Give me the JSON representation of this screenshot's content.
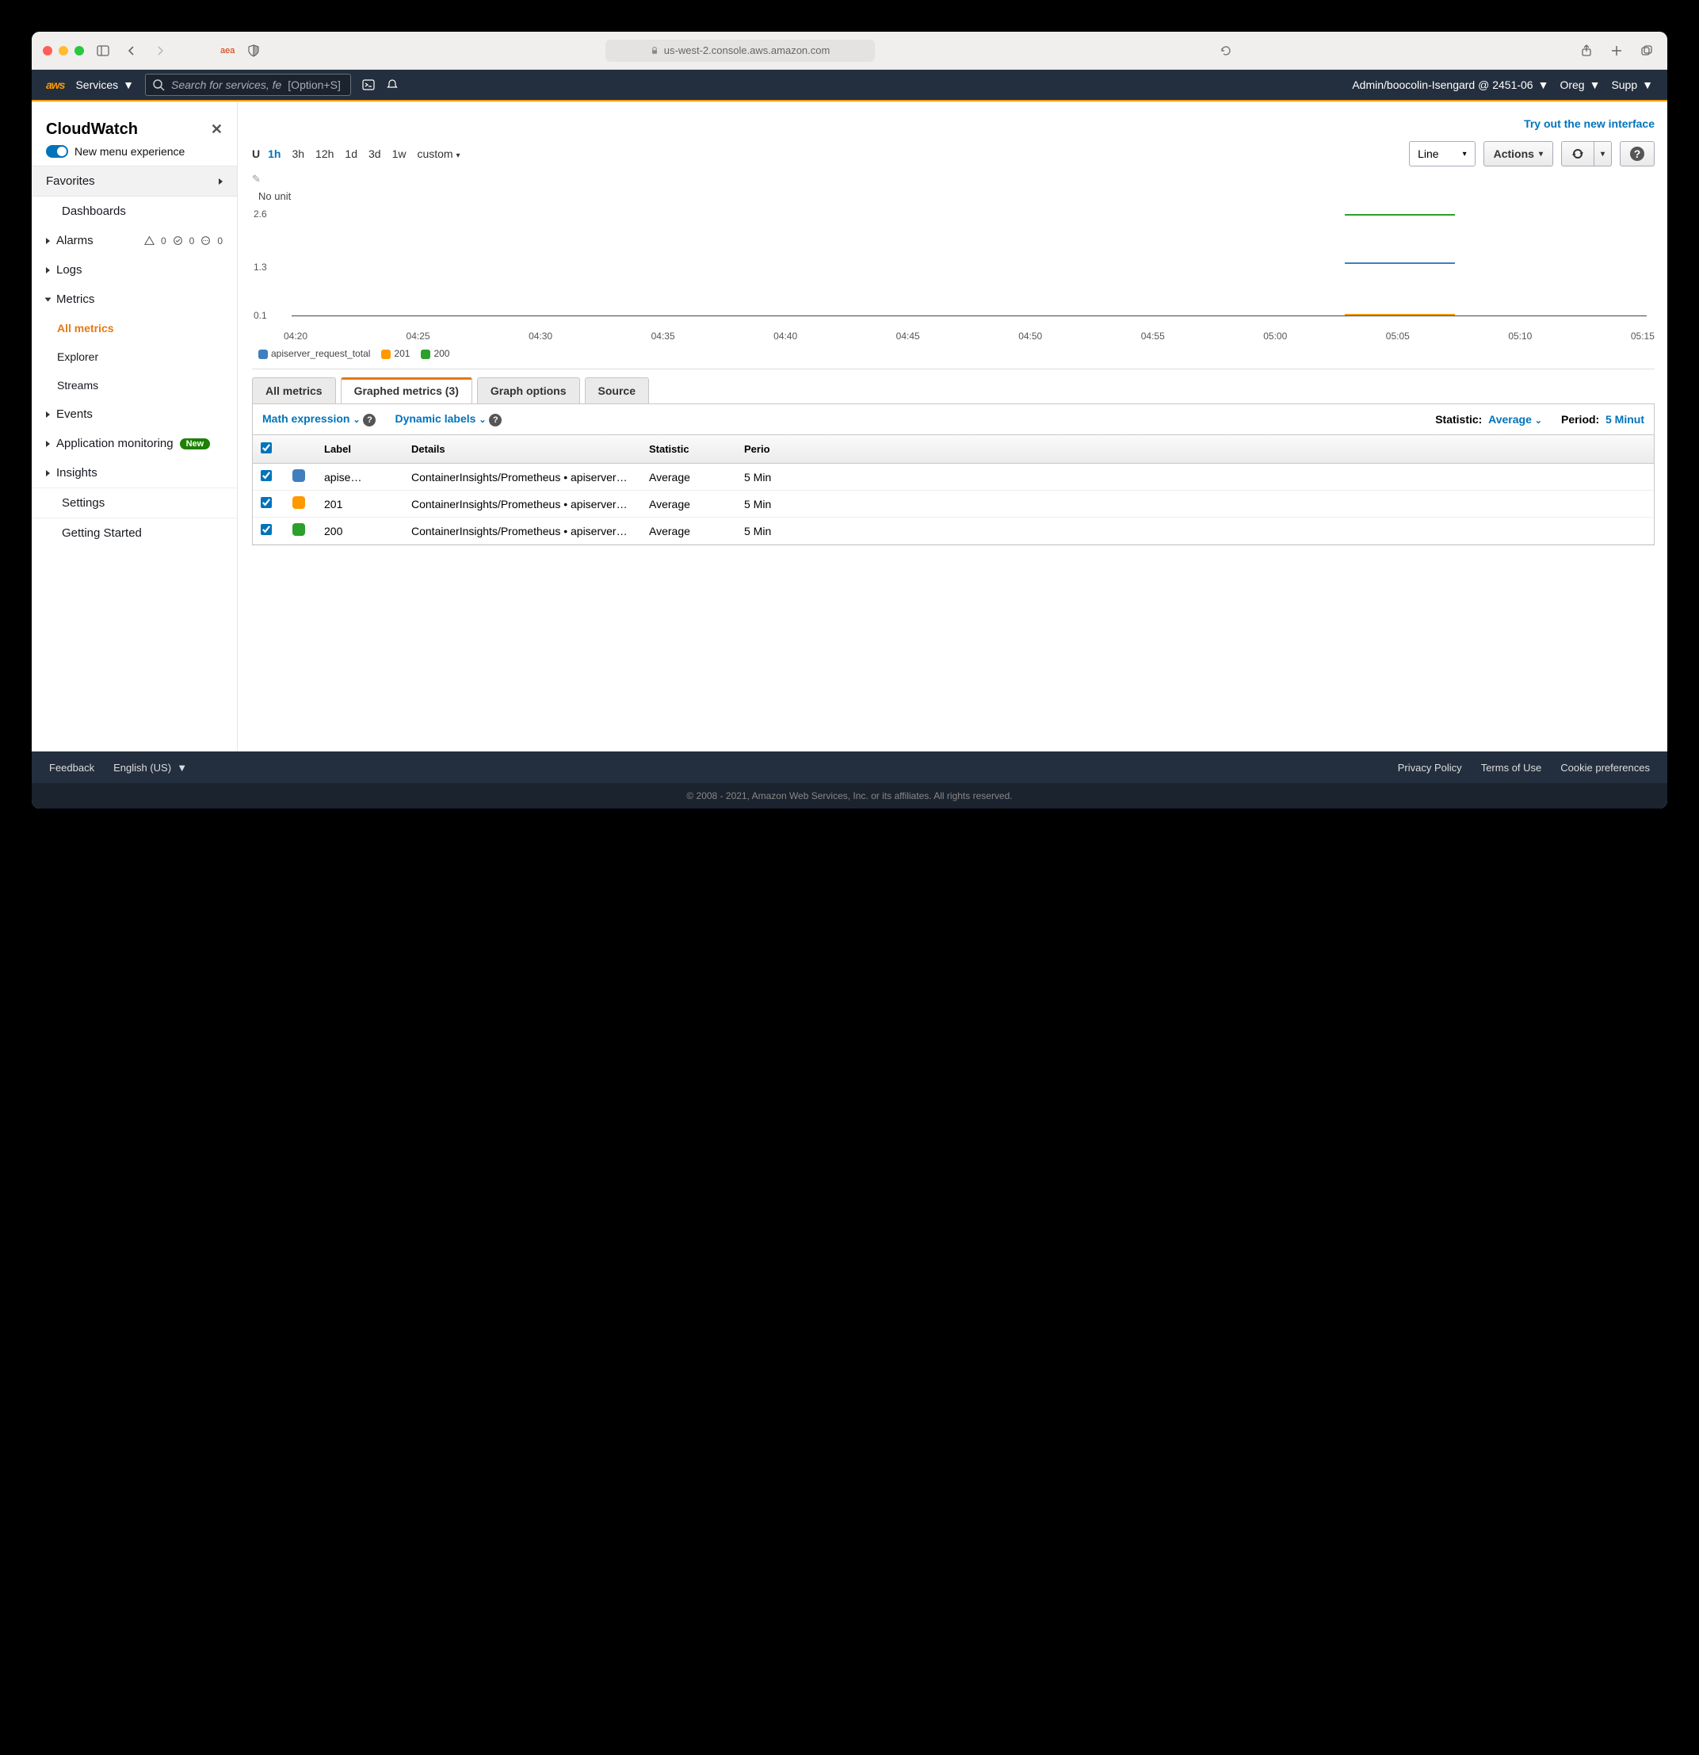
{
  "browser": {
    "url": "us-west-2.console.aws.amazon.com",
    "ext_label": "aea"
  },
  "aws_header": {
    "logo": "aws",
    "services": "Services",
    "search_placeholder": "Search for services, fe",
    "search_shortcut": "[Option+S]",
    "role": "Admin/boocolin-Isengard @ 2451-06",
    "region": "Oreg",
    "support": "Supp"
  },
  "sidebar": {
    "title": "CloudWatch",
    "new_menu": "New menu experience",
    "favorites": "Favorites",
    "items": [
      {
        "label": "Dashboards",
        "type": "plain"
      },
      {
        "label": "Alarms",
        "type": "expand",
        "counts": [
          "0",
          "0",
          "0"
        ]
      },
      {
        "label": "Logs",
        "type": "expand"
      },
      {
        "label": "Metrics",
        "type": "expanded",
        "children": [
          {
            "label": "All metrics",
            "active": true
          },
          {
            "label": "Explorer"
          },
          {
            "label": "Streams"
          }
        ]
      },
      {
        "label": "Events",
        "type": "expand"
      },
      {
        "label": "Application monitoring",
        "type": "expand",
        "badge": "New"
      },
      {
        "label": "Insights",
        "type": "expand"
      },
      {
        "label": "Settings",
        "type": "plain"
      },
      {
        "label": "Getting Started",
        "type": "plain"
      }
    ]
  },
  "main": {
    "try_link": "Try out the new interface",
    "time_ranges": [
      "1h",
      "3h",
      "12h",
      "1d",
      "3d",
      "1w",
      "custom"
    ],
    "time_active": "1h",
    "chart_type": "Line",
    "actions": "Actions",
    "y_unit": "No unit",
    "tabs": {
      "all": "All metrics",
      "graphed": "Graphed metrics (3)",
      "options": "Graph options",
      "source": "Source"
    },
    "toolbar2": {
      "math": "Math expression",
      "dyn": "Dynamic labels",
      "stat_label": "Statistic:",
      "stat_value": "Average",
      "period_label": "Period:",
      "period_value": "5 Minut"
    },
    "columns": {
      "label": "Label",
      "details": "Details",
      "statistic": "Statistic",
      "period": "Perio"
    },
    "rows": [
      {
        "color": "#3f7fbf",
        "label": "apise…",
        "details": "ContainerInsights/Prometheus • apiserver_…",
        "stat": "Average",
        "period": "5 Min"
      },
      {
        "color": "#ff9900",
        "label": "201",
        "details": "ContainerInsights/Prometheus • apiserver_…",
        "stat": "Average",
        "period": "5 Min"
      },
      {
        "color": "#2ca02c",
        "label": "200",
        "details": "ContainerInsights/Prometheus • apiserver_…",
        "stat": "Average",
        "period": "5 Min"
      }
    ]
  },
  "chart_data": {
    "type": "line",
    "title": "No unit",
    "ylabel": "",
    "ylim": [
      0.1,
      2.6
    ],
    "yticks": [
      0.1,
      1.3,
      2.6
    ],
    "x": [
      "04:20",
      "04:25",
      "04:30",
      "04:35",
      "04:40",
      "04:45",
      "04:50",
      "04:55",
      "05:00",
      "05:05",
      "05:10",
      "05:15"
    ],
    "series": [
      {
        "name": "apiserver_request_total",
        "color": "#3f7fbf",
        "values": [
          null,
          null,
          null,
          null,
          null,
          null,
          null,
          null,
          null,
          1.45,
          1.4,
          null
        ]
      },
      {
        "name": "201",
        "color": "#ff9900",
        "values": [
          null,
          null,
          null,
          null,
          null,
          null,
          null,
          null,
          null,
          0.12,
          0.12,
          null
        ]
      },
      {
        "name": "200",
        "color": "#2ca02c",
        "values": [
          null,
          null,
          null,
          null,
          null,
          null,
          null,
          null,
          null,
          2.6,
          2.55,
          null
        ]
      }
    ]
  },
  "footer": {
    "feedback": "Feedback",
    "lang": "English (US)",
    "privacy": "Privacy Policy",
    "terms": "Terms of Use",
    "cookies": "Cookie preferences",
    "copyright": "© 2008 - 2021, Amazon Web Services, Inc. or its affiliates. All rights reserved."
  }
}
